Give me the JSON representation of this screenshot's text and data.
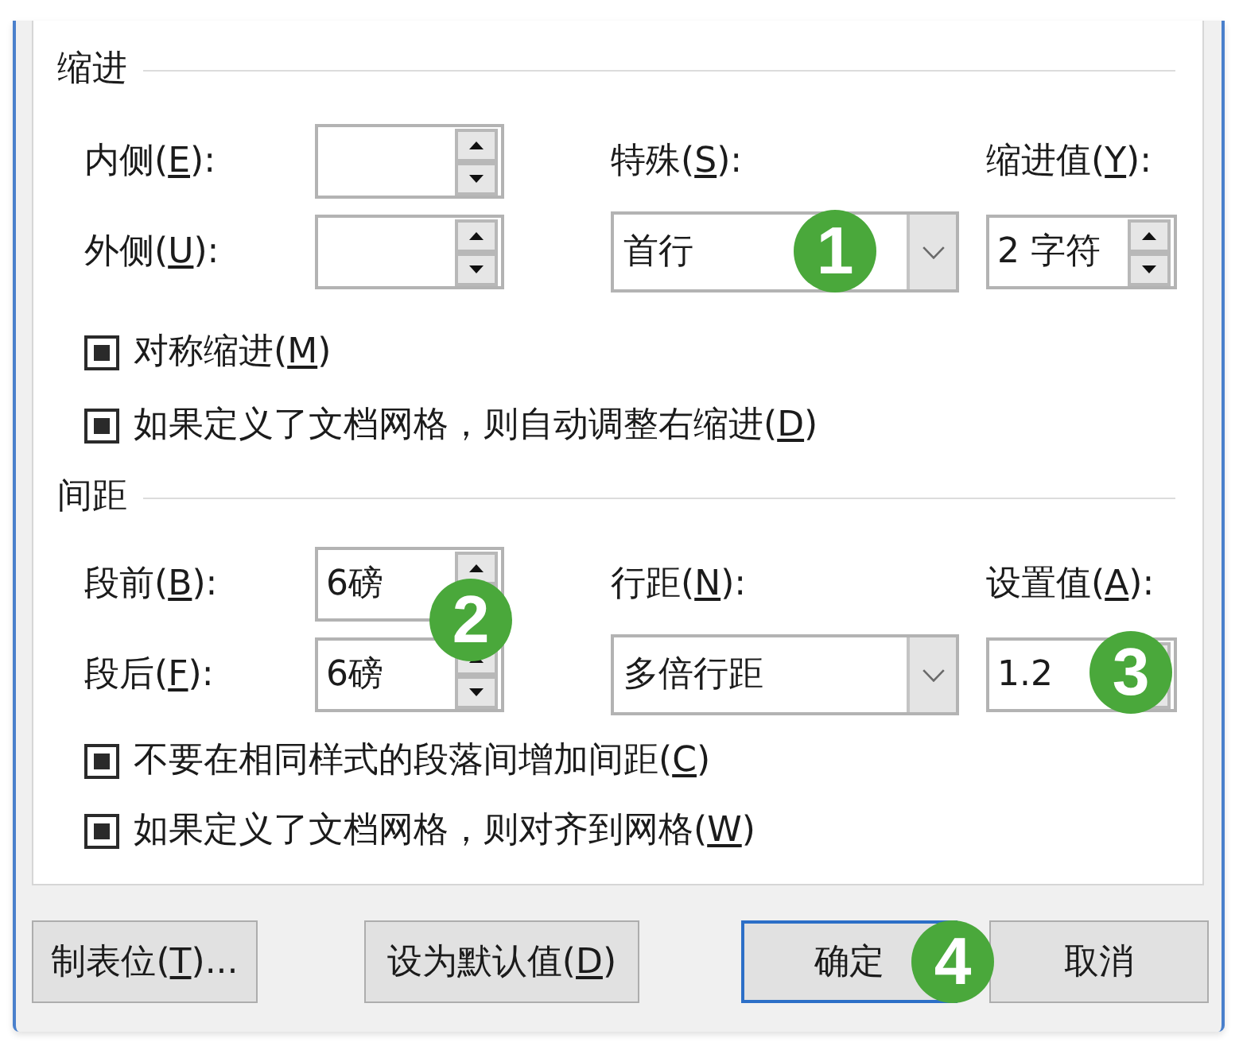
{
  "sections": [
    {
      "heading": "缩进",
      "inline_fields": [
        {
          "label": {
            "pre": "内侧(",
            "key": "E",
            "post": "):"
          },
          "kind": "spin"
        },
        {
          "label": {
            "pre": "外侧(",
            "key": "U",
            "post": "):"
          },
          "kind": "spin"
        }
      ],
      "stacked_fields": [
        {
          "label": {
            "pre": "特殊(",
            "key": "S",
            "post": "):"
          },
          "kind": "dropdown",
          "value": "首行",
          "callout": "1"
        },
        {
          "label": {
            "pre": "缩进值(",
            "key": "Y",
            "post": "):"
          },
          "kind": "spin",
          "value": "2 字符"
        }
      ],
      "checkboxes": [
        {
          "label": {
            "pre": "对称缩进(",
            "key": "M",
            "post": ")"
          },
          "checked": true
        },
        {
          "label": {
            "pre": "如果定义了文档网格，则自动调整右缩进(",
            "key": "D",
            "post": ")"
          },
          "checked": true
        }
      ]
    },
    {
      "heading": "间距",
      "inline_fields": [
        {
          "label": {
            "pre": "段前(",
            "key": "B",
            "post": "):"
          },
          "kind": "spin",
          "value": "6磅",
          "callout": "2"
        },
        {
          "label": {
            "pre": "段后(",
            "key": "F",
            "post": "):"
          },
          "kind": "spin",
          "value": "6磅"
        }
      ],
      "stacked_fields": [
        {
          "label": {
            "pre": "行距(",
            "key": "N",
            "post": "):"
          },
          "kind": "dropdown",
          "value": "多倍行距"
        },
        {
          "label": {
            "pre": "设置值(",
            "key": "A",
            "post": "):"
          },
          "kind": "spin",
          "value": "1.2",
          "callout": "3"
        }
      ],
      "checkboxes": [
        {
          "label": {
            "pre": "不要在相同样式的段落间增加间距(",
            "key": "C",
            "post": ")"
          },
          "checked": true
        },
        {
          "label": {
            "pre": "如果定义了文档网格，则对齐到网格(",
            "key": "W",
            "post": ")"
          },
          "checked": true
        }
      ]
    }
  ],
  "buttons": [
    {
      "label": {
        "pre": "制表位(",
        "key": "T",
        "post": ")..."
      },
      "default": false
    },
    {
      "label": {
        "pre": "设为默认值(",
        "key": "D",
        "post": ")"
      },
      "default": false
    },
    {
      "label": "确定",
      "default": true,
      "callout": "4"
    },
    {
      "label": "取消",
      "default": false
    }
  ]
}
